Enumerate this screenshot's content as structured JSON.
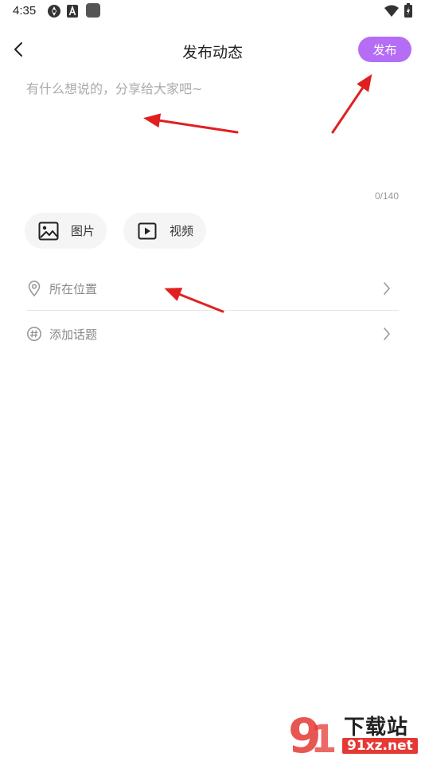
{
  "status_bar": {
    "time": "4:35",
    "icons": [
      "sync-icon",
      "a-badge-icon",
      "square-app-icon",
      "wifi-icon",
      "battery-charging-icon"
    ]
  },
  "header": {
    "back_icon": "chevron-left-icon",
    "title": "发布动态",
    "publish_label": "发布",
    "publish_color": "#b56df5"
  },
  "editor": {
    "placeholder": "有什么想说的，分享给大家吧~",
    "value": "",
    "char_count": "0/140"
  },
  "media_buttons": [
    {
      "label": "图片",
      "icon": "image-icon"
    },
    {
      "label": "视频",
      "icon": "video-play-icon"
    }
  ],
  "options": [
    {
      "label": "所在位置",
      "icon": "location-pin-icon",
      "chevron": "chevron-right-icon"
    },
    {
      "label": "添加话题",
      "icon": "hashtag-icon",
      "chevron": "chevron-right-icon"
    }
  ],
  "annotation_color": "#e02020",
  "watermark": {
    "brand_text": "下载站",
    "domain_text": "91xz.net",
    "colors": {
      "brand_red": "#e53935"
    }
  }
}
